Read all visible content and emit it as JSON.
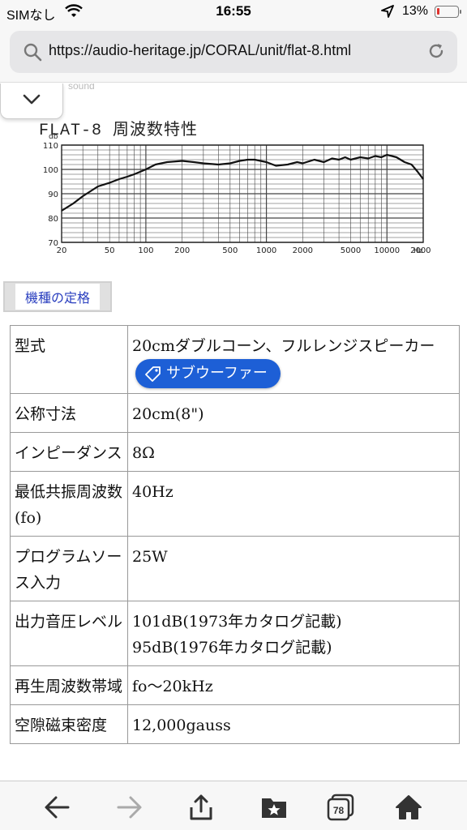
{
  "status_bar": {
    "carrier": "SIMなし",
    "time": "16:55",
    "battery": "13%",
    "battery_level": 0.13
  },
  "browser": {
    "url": "https://audio-heritage.jp/CORAL/unit/flat-8.html",
    "tab_count": "78"
  },
  "page": {
    "faint_text": "sound",
    "graph": {
      "title": "FLAT-8 周波数特性",
      "y_unit": "db",
      "x_unit": "Hz"
    },
    "spec_button_label": "機種の定格",
    "spec_rows": [
      {
        "key": "型式",
        "value": "20cmダブルコーン、フルレンジスピーカー"
      },
      {
        "key": "公称寸法",
        "value": "20cm(8\")"
      },
      {
        "key": "インピーダンス",
        "value": "8Ω"
      },
      {
        "key": "最低共振周波数(fo)",
        "value": "40Hz"
      },
      {
        "key": "プログラムソース入力",
        "value": "25W"
      },
      {
        "key": "出力音圧レベル",
        "value": "101dB(1973年カタログ記載)",
        "value2": "95dB(1976年カタログ記載)"
      },
      {
        "key": "再生周波数帯域",
        "value": "fo〜20kHz"
      },
      {
        "key": "空隙磁束密度",
        "value": "12,000gauss"
      }
    ],
    "tag_pill_label": "サブウーファー"
  },
  "chart_data": {
    "type": "line",
    "title": "FLAT-8 周波数特性",
    "xlabel": "Hz",
    "ylabel": "db",
    "x_scale": "log",
    "xlim": [
      20,
      20000
    ],
    "ylim": [
      70,
      110
    ],
    "x_ticks": [
      "20",
      "50",
      "100",
      "200",
      "500",
      "1000",
      "2000",
      "5000",
      "10000",
      "20000"
    ],
    "y_ticks": [
      "70",
      "80",
      "90",
      "100",
      "110"
    ],
    "grid": true,
    "series": [
      {
        "x": [
          20,
          25,
          30,
          40,
          50,
          60,
          70,
          80,
          100,
          120,
          150,
          200,
          250,
          300,
          400,
          500,
          600,
          700,
          800,
          1000,
          1200,
          1500,
          1800,
          2000,
          2500,
          3000,
          3500,
          4000,
          4500,
          5000,
          6000,
          7000,
          8000,
          9000,
          10000,
          11000,
          12000,
          14000,
          16000,
          18000,
          20000
        ],
        "y": [
          83,
          86,
          89,
          93,
          94.5,
          96,
          97,
          98,
          100,
          102,
          103,
          103.5,
          103,
          102.5,
          102,
          102.5,
          103.5,
          104,
          104,
          103,
          101.5,
          102,
          103,
          102.5,
          104,
          103,
          104.5,
          104,
          105,
          104,
          105,
          104.5,
          105.5,
          105,
          106,
          105.5,
          105,
          103,
          102,
          99,
          96
        ]
      }
    ]
  }
}
